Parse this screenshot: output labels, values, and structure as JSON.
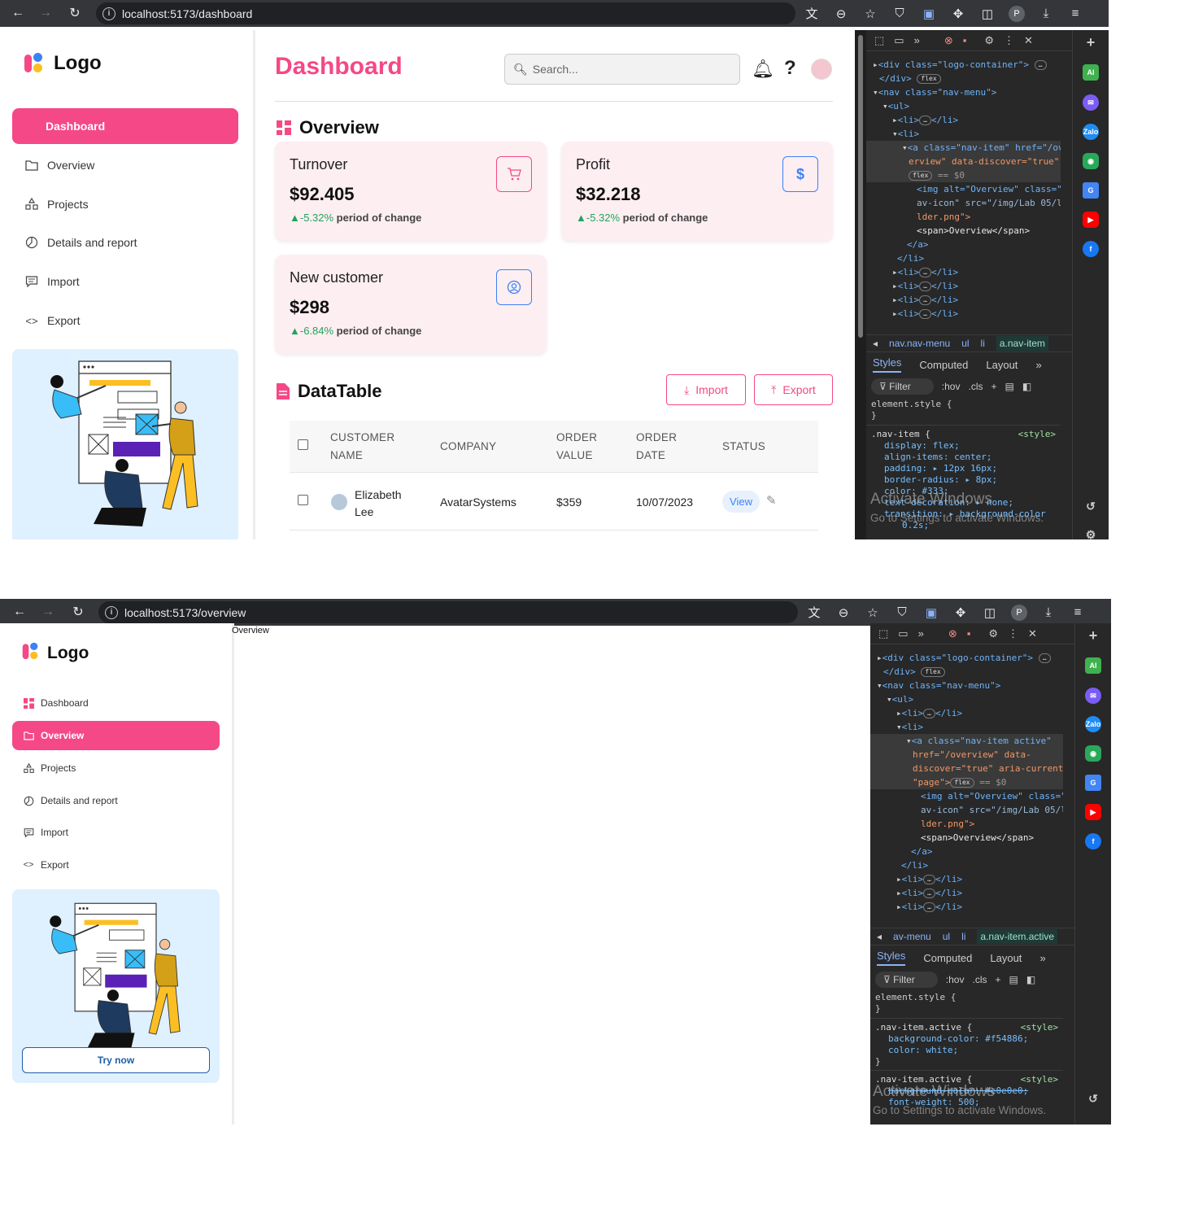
{
  "shot1": {
    "url": "localhost:5173/dashboard",
    "logo_text": "Logo",
    "nav": [
      {
        "label": "Dashboard",
        "icon": "grid-icon",
        "active": true
      },
      {
        "label": "Overview",
        "icon": "folder-icon",
        "active": false
      },
      {
        "label": "Projects",
        "icon": "projects-icon",
        "active": false
      },
      {
        "label": "Details and report",
        "icon": "chart-icon",
        "active": false
      },
      {
        "label": "Import",
        "icon": "message-icon",
        "active": false
      },
      {
        "label": "Export",
        "icon": "code-icon",
        "active": false
      }
    ],
    "page_title": "Dashboard",
    "search_placeholder": "Search...",
    "overview_title": "Overview",
    "cards": [
      {
        "label": "Turnover",
        "value": "$92.405",
        "change": "▲-5.32%",
        "change_text": " period of change",
        "icon": "cart-icon"
      },
      {
        "label": "Profit",
        "value": "$32.218",
        "change": "▲-5.32%",
        "change_text": " period of change",
        "icon": "dollar-icon"
      },
      {
        "label": "New customer",
        "value": "$298",
        "change": "▲-6.84%",
        "change_text": " period of change",
        "icon": "user-icon"
      }
    ],
    "datatable_title": "DataTable",
    "import_label": "Import",
    "export_label": "Export",
    "columns": [
      "CUSTOMER NAME",
      "COMPANY",
      "ORDER VALUE",
      "ORDER DATE",
      "STATUS"
    ],
    "columns_wrapped": [
      [
        "CUSTOMER",
        "NAME"
      ],
      [
        "COMPANY"
      ],
      [
        "ORDER",
        "VALUE"
      ],
      [
        "ORDER",
        "DATE"
      ],
      [
        "STATUS"
      ]
    ],
    "rows": [
      {
        "name_line1": "Elizabeth",
        "name_line2": "Lee",
        "company": "AvatarSystems",
        "value": "$359",
        "date": "10/07/2023",
        "status": "View"
      }
    ],
    "devtools": {
      "crumbs": [
        "nav.nav-menu",
        "ul",
        "li",
        "a.nav-item"
      ],
      "tabs": [
        "Styles",
        "Computed",
        "Layout"
      ],
      "filter": "Filter",
      "hov": ":hov",
      "cls": ".cls",
      "dom_lines": [
        "<div class=\"logo-container\">",
        "</div>",
        "<nav class=\"nav-menu\">",
        "<ul>",
        "<li>",
        "</li>",
        "<li>",
        "<a class=\"nav-item\" href=\"/ov",
        "erview\" data-discover=\"true\"",
        "== $0",
        "<img alt=\"Overview\" class=\"n",
        "av-icon\" src=\"/img/Lab 05/l",
        "lder.png\">",
        "<span>Overview</span>",
        "</a>",
        "</li>"
      ],
      "css_lines": [
        "element.style {",
        "}",
        ".nav-item {",
        "display: flex;",
        "align-items: center;",
        "padding: ▸ 12px 16px;",
        "border-radius: ▸ 8px;",
        "color: #333;",
        "text-decoration: ▸ none;",
        "transition: ▸ background-color",
        "0.2s;"
      ],
      "style_tag": "<style>",
      "watermark1": "Activate Windows",
      "watermark2": "Go to Settings to activate Windows."
    }
  },
  "shot2": {
    "url": "localhost:5173/overview",
    "logo_text": "Logo",
    "content_text": "Overview",
    "nav": [
      {
        "label": "Dashboard",
        "icon": "grid-icon",
        "active": false
      },
      {
        "label": "Overview",
        "icon": "folder-icon",
        "active": true
      },
      {
        "label": "Projects",
        "icon": "projects-icon",
        "active": false
      },
      {
        "label": "Details and report",
        "icon": "chart-icon",
        "active": false
      },
      {
        "label": "Import",
        "icon": "message-icon",
        "active": false
      },
      {
        "label": "Export",
        "icon": "code-icon",
        "active": false
      }
    ],
    "try_now": "Try now",
    "devtools": {
      "crumbs": [
        "av-menu",
        "ul",
        "li",
        "a.nav-item.active"
      ],
      "tabs": [
        "Styles",
        "Computed",
        "Layout"
      ],
      "filter": "Filter",
      "hov": ":hov",
      "cls": ".cls",
      "dom_lines": [
        "<div class=\"logo-container\">",
        "</div>",
        "<nav class=\"nav-menu\">",
        "<ul>",
        "<li>",
        "</li>",
        "<li>",
        "<a class=\"nav-item active\"",
        "href=\"/overview\" data-",
        "discover=\"true\" aria-current",
        "\"page\">",
        "== $0",
        "<img alt=\"Overview\" class=\"n",
        "av-icon\" src=\"/img/Lab 05/l",
        "lder.png\">",
        "<span>Overview</span>",
        "</a>",
        "</li>"
      ],
      "css_lines": [
        "element.style {",
        "}",
        ".nav-item.active {",
        "background-color: #f54886;",
        "color: white;",
        "}",
        ".nav-item.active {",
        "background-color: #e0e0e0;",
        "font-weight: 500;"
      ],
      "style_tag": "<style>",
      "watermark1": "Activate Windows",
      "watermark2": "Go to Settings to activate Windows."
    }
  },
  "colors": {
    "accent": "#f54886",
    "blue": "#3b82f6",
    "green": "#22a35b"
  }
}
